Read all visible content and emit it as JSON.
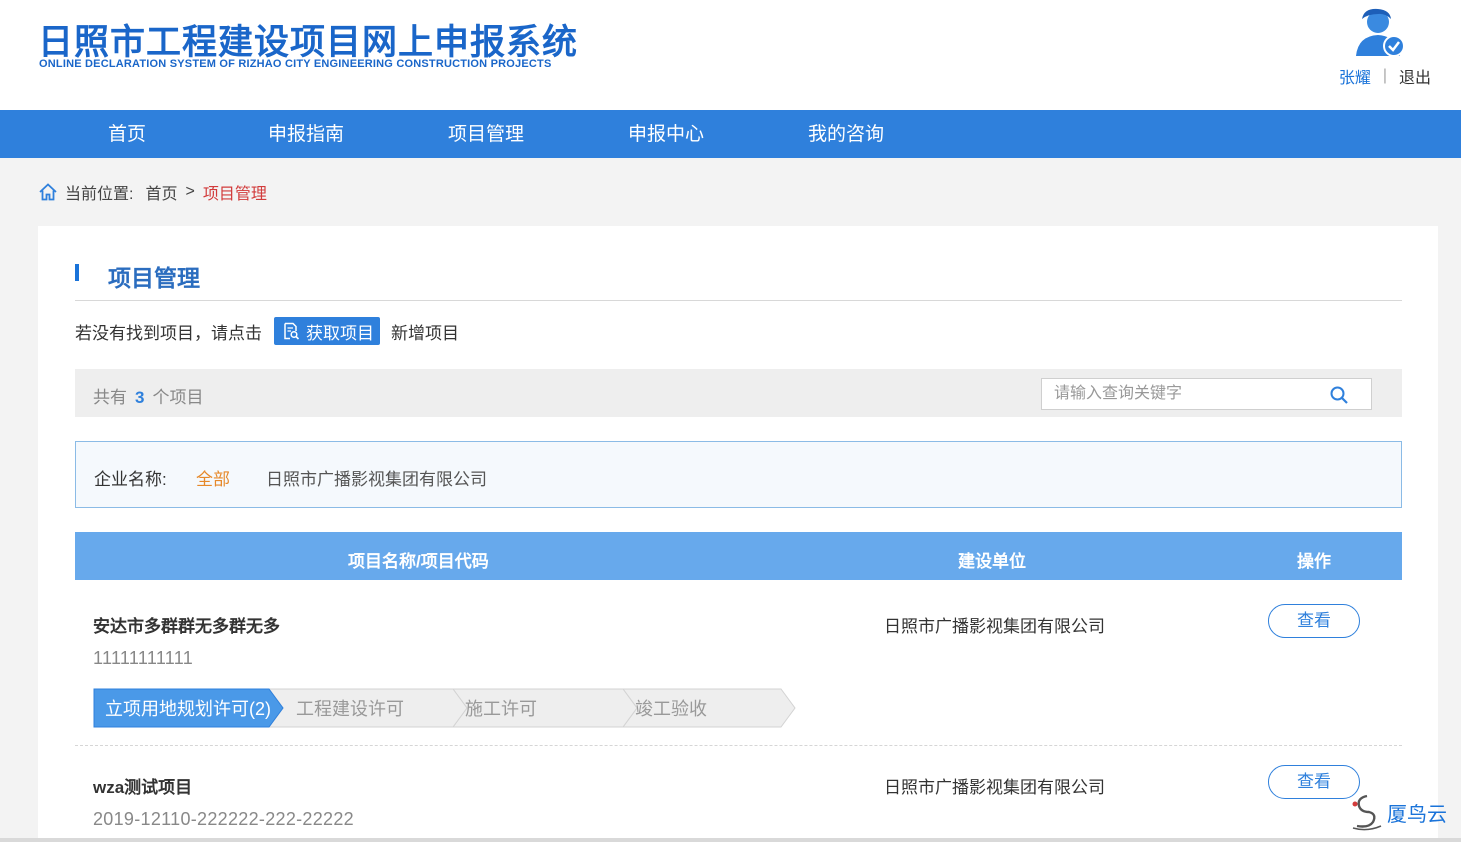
{
  "header": {
    "title_cn": "日照市工程建设项目网上申报系统",
    "title_en": "ONLINE DECLARATION SYSTEM OF RIZHAO CITY ENGINEERING CONSTRUCTION PROJECTS",
    "user_name": "张耀",
    "separator": "|",
    "logout": "退出",
    "avatar_icon": "user-avatar-icon"
  },
  "nav": {
    "items": [
      "首页",
      "申报指南",
      "项目管理",
      "申报中心",
      "我的咨询"
    ]
  },
  "breadcrumb": {
    "prefix": "当前位置:",
    "home": "首页",
    "arrow": ">",
    "current": "项目管理"
  },
  "panel": {
    "title": "项目管理",
    "hint_before": "若没有找到项目，请点击",
    "get_button": "获取项目",
    "hint_after": "新增项目",
    "count_prefix": "共有",
    "count": "3",
    "count_suffix": "个项目",
    "search_placeholder": "请输入查询关键字",
    "filter_label": "企业名称:",
    "filter_all": "全部",
    "filter_org": "日照市广播影视集团有限公司"
  },
  "table": {
    "headers": [
      "项目名称/项目代码",
      "建设单位",
      "操作"
    ],
    "rows": [
      {
        "name": "安达市多群群无多群无多",
        "code": "11111111111",
        "org": "日照市广播影视集团有限公司",
        "action": "查看",
        "steps": [
          "立项用地规划许可(2)",
          "工程建设许可",
          "施工许可",
          "竣工验收"
        ],
        "active_step": 0
      },
      {
        "name": "wza测试项目",
        "code": "2019-12110-222222-222-22222",
        "org": "日照市广播影视集团有限公司",
        "action": "查看"
      }
    ]
  },
  "watermark": {
    "text": "厦鸟云"
  },
  "colors": {
    "primary": "#2f80dc",
    "title_blue": "#1a66c9",
    "table_header": "#67a9ec",
    "crumb_current": "#d23b3b",
    "filter_all": "#e6892a"
  }
}
